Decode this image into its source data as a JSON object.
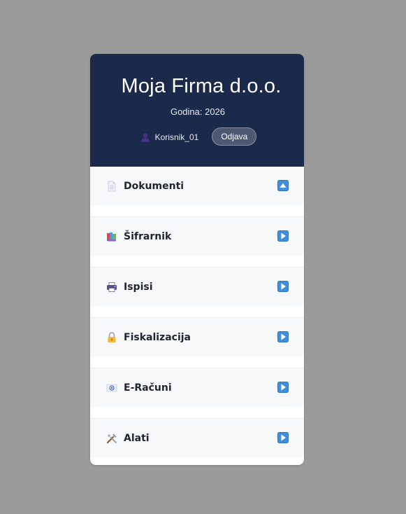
{
  "header": {
    "company": "Moja Firma d.o.o.",
    "year": "Godina: 2026",
    "username": "Korisnik_01",
    "logout_label": "Odjava"
  },
  "menu": {
    "items": [
      {
        "label": "Dokumenti",
        "icon": "document-icon",
        "state": "expanded"
      },
      {
        "label": "Šifrarnik",
        "icon": "books-icon",
        "state": "collapsed"
      },
      {
        "label": "Ispisi",
        "icon": "printer-icon",
        "state": "collapsed"
      },
      {
        "label": "Fiskalizacija",
        "icon": "lock-icon",
        "state": "collapsed"
      },
      {
        "label": "E-Računi",
        "icon": "email-icon",
        "state": "collapsed"
      },
      {
        "label": "Alati",
        "icon": "tools-icon",
        "state": "collapsed"
      }
    ]
  },
  "colors": {
    "header_bg": "#1b294b",
    "menu_bg": "#f6f8fa",
    "toggle_blue": "#3f8fdc"
  }
}
